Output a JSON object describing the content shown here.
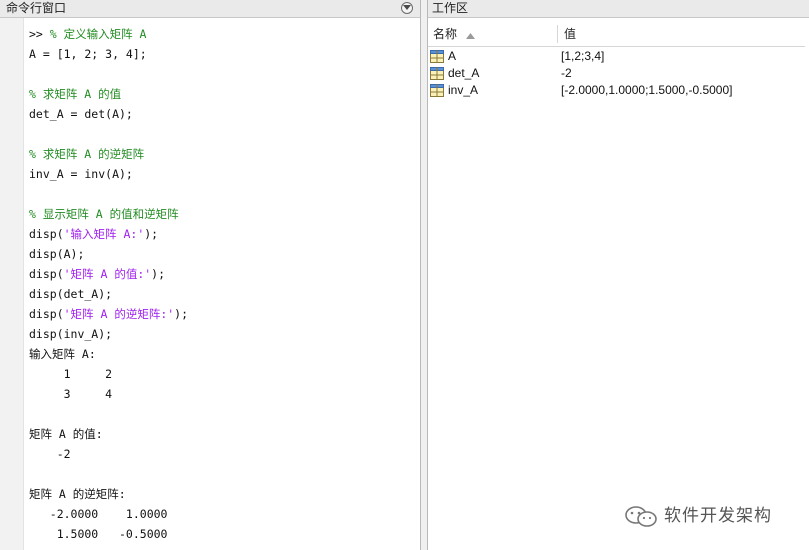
{
  "command_window": {
    "title": "命令行窗口",
    "lines": [
      [
        {
          "t": ">> ",
          "c": "plain"
        },
        {
          "t": "% 定义输入矩阵 A",
          "c": "comment"
        }
      ],
      [
        {
          "t": "A = [1, 2; 3, 4];",
          "c": "plain"
        }
      ],
      [],
      [
        {
          "t": "% 求矩阵 A 的值",
          "c": "comment"
        }
      ],
      [
        {
          "t": "det_A = det(A);",
          "c": "plain"
        }
      ],
      [],
      [
        {
          "t": "% 求矩阵 A 的逆矩阵",
          "c": "comment"
        }
      ],
      [
        {
          "t": "inv_A = inv(A);",
          "c": "plain"
        }
      ],
      [],
      [
        {
          "t": "% 显示矩阵 A 的值和逆矩阵",
          "c": "comment"
        }
      ],
      [
        {
          "t": "disp(",
          "c": "plain"
        },
        {
          "t": "'输入矩阵 A:'",
          "c": "string"
        },
        {
          "t": ");",
          "c": "plain"
        }
      ],
      [
        {
          "t": "disp(A);",
          "c": "plain"
        }
      ],
      [
        {
          "t": "disp(",
          "c": "plain"
        },
        {
          "t": "'矩阵 A 的值:'",
          "c": "string"
        },
        {
          "t": ");",
          "c": "plain"
        }
      ],
      [
        {
          "t": "disp(det_A);",
          "c": "plain"
        }
      ],
      [
        {
          "t": "disp(",
          "c": "plain"
        },
        {
          "t": "'矩阵 A 的逆矩阵:'",
          "c": "string"
        },
        {
          "t": ");",
          "c": "plain"
        }
      ],
      [
        {
          "t": "disp(inv_A);",
          "c": "plain"
        }
      ],
      [
        {
          "t": "输入矩阵 A:",
          "c": "plain"
        }
      ],
      [
        {
          "t": "     1     2",
          "c": "plain"
        }
      ],
      [
        {
          "t": "     3     4",
          "c": "plain"
        }
      ],
      [],
      [
        {
          "t": "矩阵 A 的值:",
          "c": "plain"
        }
      ],
      [
        {
          "t": "    -2",
          "c": "plain"
        }
      ],
      [],
      [
        {
          "t": "矩阵 A 的逆矩阵:",
          "c": "plain"
        }
      ],
      [
        {
          "t": "   -2.0000    1.0000",
          "c": "plain"
        }
      ],
      [
        {
          "t": "    1.5000   -0.5000",
          "c": "plain"
        }
      ]
    ]
  },
  "workspace": {
    "title": "工作区",
    "columns": {
      "name": "名称",
      "value": "值"
    },
    "variables": [
      {
        "name": "A",
        "value": "[1,2;3,4]"
      },
      {
        "name": "det_A",
        "value": "-2"
      },
      {
        "name": "inv_A",
        "value": "[-2.0000,1.0000;1.5000,-0.5000]"
      }
    ]
  },
  "watermark": {
    "text": "软件开发架构"
  },
  "colors": {
    "comment": "#228b22",
    "string": "#a020f0"
  }
}
